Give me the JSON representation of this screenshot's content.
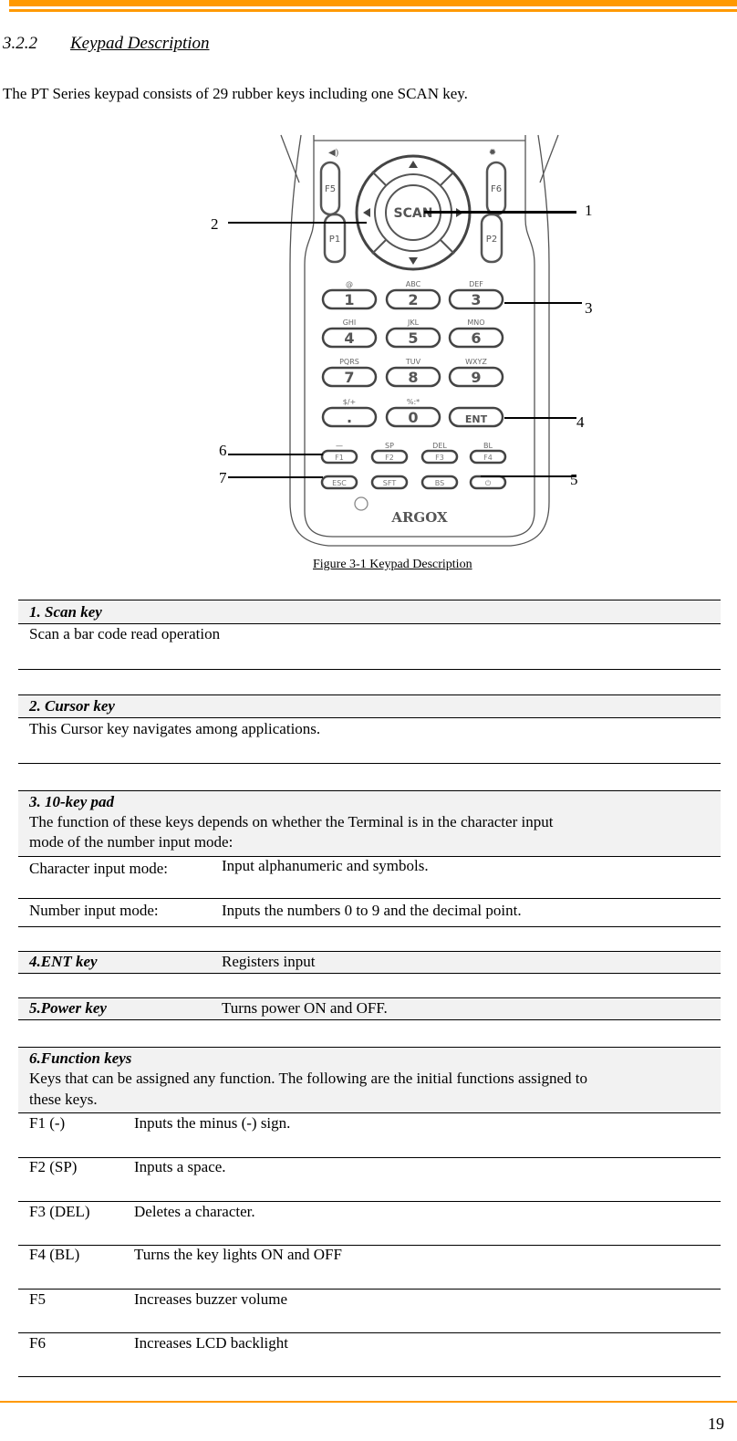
{
  "heading": {
    "number": "3.2.2",
    "title": "Keypad Description"
  },
  "intro": "The PT Series keypad consists of 29 rubber keys including one SCAN key.",
  "figure": {
    "caption": "Figure 3-1 Keypad Description",
    "callouts": [
      "1",
      "2",
      "3",
      "4",
      "5",
      "6",
      "7"
    ],
    "scan_label": "SCAN",
    "brand": "ARGOX",
    "side_keys": [
      "F5",
      "P1",
      "F6",
      "P2"
    ],
    "number_keys": [
      {
        "sub": "@",
        "key": "1"
      },
      {
        "sub": "ABC",
        "key": "2"
      },
      {
        "sub": "DEF",
        "key": "3"
      },
      {
        "sub": "GHI",
        "key": "4"
      },
      {
        "sub": "JKL",
        "key": "5"
      },
      {
        "sub": "MNO",
        "key": "6"
      },
      {
        "sub": "PQRS",
        "key": "7"
      },
      {
        "sub": "TUV",
        "key": "8"
      },
      {
        "sub": "WXYZ",
        "key": "9"
      },
      {
        "sub": "$/+",
        "key": "."
      },
      {
        "sub": "%:*",
        "key": "0"
      },
      {
        "sub": "",
        "key": "ENT"
      }
    ],
    "function_keys": [
      {
        "sub": "—",
        "key": "F1"
      },
      {
        "sub": "SP",
        "key": "F2"
      },
      {
        "sub": "DEL",
        "key": "F3"
      },
      {
        "sub": "BL",
        "key": "F4"
      }
    ],
    "bottom_keys": [
      "ESC",
      "SFT",
      "BS",
      "⏻"
    ]
  },
  "sections": {
    "scan": {
      "title": "1. Scan key",
      "body": "Scan a bar code read operation"
    },
    "cursor": {
      "title": "2. Cursor key",
      "body": "This Cursor key navigates among applications."
    },
    "keypad": {
      "title": "3. 10-key pad",
      "body1": "The function of these keys depends on whether the Terminal is in the character input",
      "body2": "mode of the number input mode:",
      "rows": [
        {
          "mode": "Character input mode:",
          "desc": "Input alphanumeric and symbols."
        },
        {
          "mode": "Number input mode:",
          "desc": "Inputs the numbers 0 to 9 and the decimal point."
        }
      ]
    },
    "ent": {
      "title": "4.ENT key",
      "desc": "Registers input"
    },
    "power": {
      "title": "5.Power key",
      "desc": "Turns power ON and OFF."
    },
    "function": {
      "title": "6.Function keys",
      "body1": "Keys that can be assigned any function. The following are the initial functions assigned to",
      "body2": "these keys.",
      "rows": [
        {
          "key": "F1 (-)",
          "desc": "Inputs the minus (-) sign."
        },
        {
          "key": "F2 (SP)",
          "desc": "Inputs a space."
        },
        {
          "key": "F3 (DEL)",
          "desc": "Deletes a character."
        },
        {
          "key": "F4 (BL)",
          "desc": "Turns the key lights ON and OFF"
        },
        {
          "key": "F5",
          "desc": "Increases buzzer volume"
        },
        {
          "key": "F6",
          "desc": "Increases LCD backlight"
        }
      ]
    }
  },
  "footer": {
    "page_number": "19"
  },
  "colors": {
    "accent": "#ff9900",
    "shade": "#f2f2f2"
  }
}
